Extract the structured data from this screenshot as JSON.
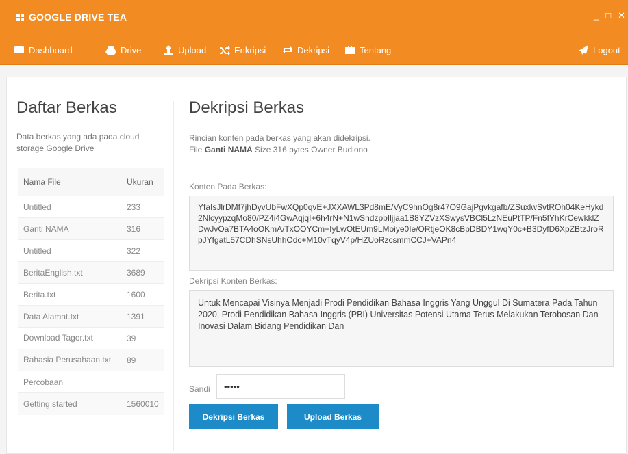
{
  "app": {
    "title": "GOOGLE DRIVE TEA",
    "accent_color": "#f28c22",
    "button_color": "#1e8bc9"
  },
  "window_controls": {
    "minimize": "_",
    "maximize": "□",
    "close": "✕"
  },
  "menu": {
    "dashboard": {
      "label": "Dashboard",
      "icon": "dashboard-icon"
    },
    "drive": {
      "label": "Drive",
      "icon": "drive-icon"
    },
    "upload": {
      "label": "Upload",
      "icon": "upload-icon"
    },
    "enkripsi": {
      "label": "Enkripsi",
      "icon": "shuffle-icon"
    },
    "dekripsi": {
      "label": "Dekripsi",
      "icon": "repeat-icon"
    },
    "tentang": {
      "label": "Tentang",
      "icon": "briefcase-icon"
    },
    "logout": {
      "label": "Logout",
      "icon": "logout-icon"
    }
  },
  "sidebar": {
    "title": "Daftar Berkas",
    "description": "Data berkas yang ada pada cloud storage Google Drive",
    "columns": {
      "name": "Nama File",
      "size": "Ukuran"
    },
    "files": [
      {
        "name": "Untitled",
        "size": "233"
      },
      {
        "name": "Ganti NAMA",
        "size": "316"
      },
      {
        "name": "Untitled",
        "size": "322"
      },
      {
        "name": "BeritaEnglish.txt",
        "size": "3689"
      },
      {
        "name": "Berita.txt",
        "size": "1600"
      },
      {
        "name": "Data Alamat.txt",
        "size": "1391"
      },
      {
        "name": "Download Tagor.txt",
        "size": "39"
      },
      {
        "name": "Rahasia Perusahaan.txt",
        "size": "89"
      },
      {
        "name": "Percobaan",
        "size": ""
      },
      {
        "name": "Getting started",
        "size": "1560010"
      }
    ]
  },
  "main": {
    "title": "Dekripsi Berkas",
    "description": "Rincian konten pada berkas yang akan didekripsi.",
    "file_prefix": "File",
    "file_name": "Ganti NAMA",
    "size_prefix": "Size",
    "size_value": "316 bytes",
    "owner_prefix": "Owner",
    "owner_value": "Budiono",
    "content_label": "Konten Pada Berkas:",
    "content_value": "YfaIsJlrDMf7jhDyvUbFwXQp0qvE+JXXAWL3Pd8mE/VyC9hnOg8r47O9GajPgvkgafb/ZSuxlwSvtROh04KeHykd2NlcyypzqMo80/PZ4i4GwAqjqI+6h4rN+N1wSndzpbIljjaa1B8YZVzXSwysVBCl5LzNEuPtTP/Fn5fYhKrCewkklZDwJvOa7BTA4oOKmA/TxOOYCm+IyLwOtEUm9LMoiye0Ie/ORtjeOK8cBpDBDY1wqY0c+B3DyfD6XpZBtzJroRpJYfgatL57CDhSNsUhhOdc+M10vTqyV4p/HZUoRzcsmmCCJ+VAPn4=",
    "decrypted_label": "Dekripsi Konten Berkas:",
    "decrypted_value": "Untuk Mencapai Visinya Menjadi Prodi Pendidikan Bahasa Inggris Yang Unggul Di Sumatera Pada Tahun 2020, Prodi Pendidikan Bahasa Inggris (PBI) Universitas Potensi Utama Terus Melakukan Terobosan Dan Inovasi Dalam Bidang Pendidikan Dan",
    "password_label": "Sandi",
    "password_value": "•••••",
    "decrypt_button": "Dekripsi Berkas",
    "upload_button": "Upload Berkas"
  }
}
